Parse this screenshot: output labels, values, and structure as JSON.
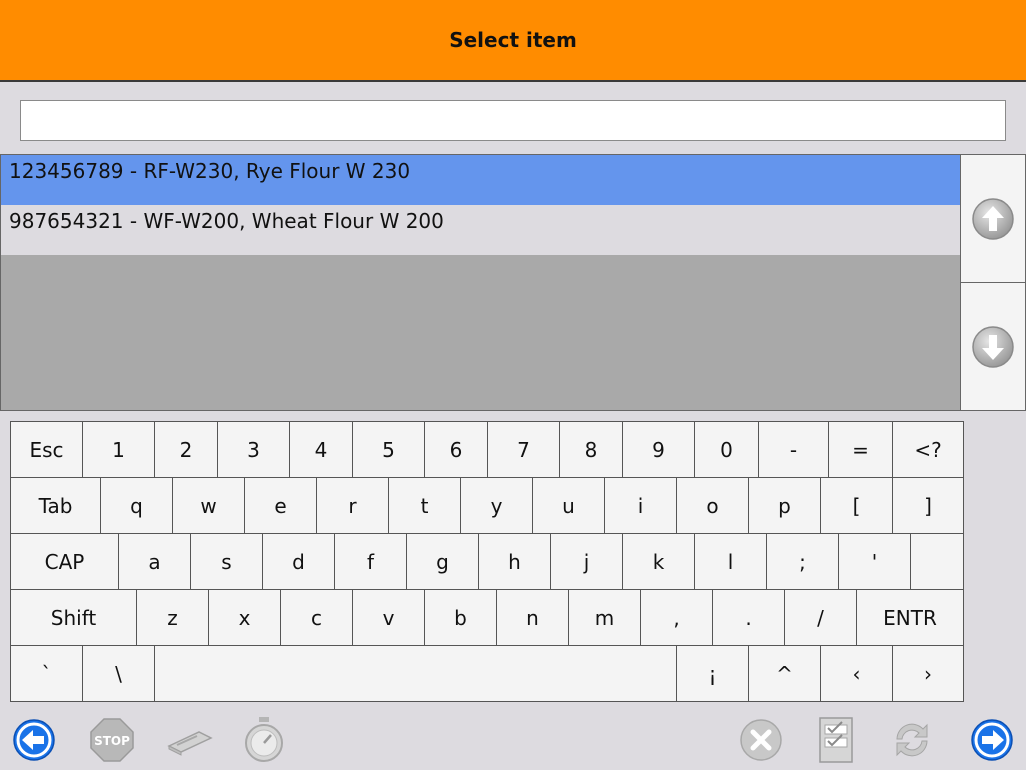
{
  "header": {
    "title": "Select item"
  },
  "search": {
    "value": ""
  },
  "list": {
    "items": [
      {
        "text": "123456789 - RF-W230, Rye Flour W 230",
        "selected": true
      },
      {
        "text": "987654321 - WF-W200, Wheat Flour W 200",
        "selected": false
      }
    ]
  },
  "scroll": {
    "up_icon": "arrow-up-icon",
    "down_icon": "arrow-down-icon"
  },
  "keyboard": {
    "row1": [
      "Esc",
      "1",
      "2",
      "3",
      "4",
      "5",
      "6",
      "7",
      "8",
      "9",
      "0",
      "-",
      "=",
      "<?"
    ],
    "row2": [
      "Tab",
      "q",
      "w",
      "e",
      "r",
      "t",
      "y",
      "u",
      "i",
      "o",
      "p",
      "[",
      "]"
    ],
    "row3": [
      "CAP",
      "a",
      "s",
      "d",
      "f",
      "g",
      "h",
      "j",
      "k",
      "l",
      ";",
      "'",
      ""
    ],
    "row4": [
      "Shift",
      "z",
      "x",
      "c",
      "v",
      "b",
      "n",
      "m",
      ",",
      ".",
      "/",
      "ENTR"
    ],
    "row5": [
      "`",
      "\\",
      "",
      "¡",
      "^",
      "‹",
      "›"
    ]
  },
  "toolbar": {
    "stop_label": "STOP",
    "icons": [
      "back-arrow-icon",
      "stop-sign-icon",
      "scanner-icon",
      "stopwatch-icon",
      "cancel-icon",
      "checklist-icon",
      "refresh-icon",
      "forward-arrow-icon"
    ]
  },
  "colors": {
    "header": "#ff8c00",
    "selected_row": "#6495ed",
    "background": "#dddbe0",
    "list_empty": "#a9a9a9",
    "nav_blue": "#1a73e8"
  }
}
